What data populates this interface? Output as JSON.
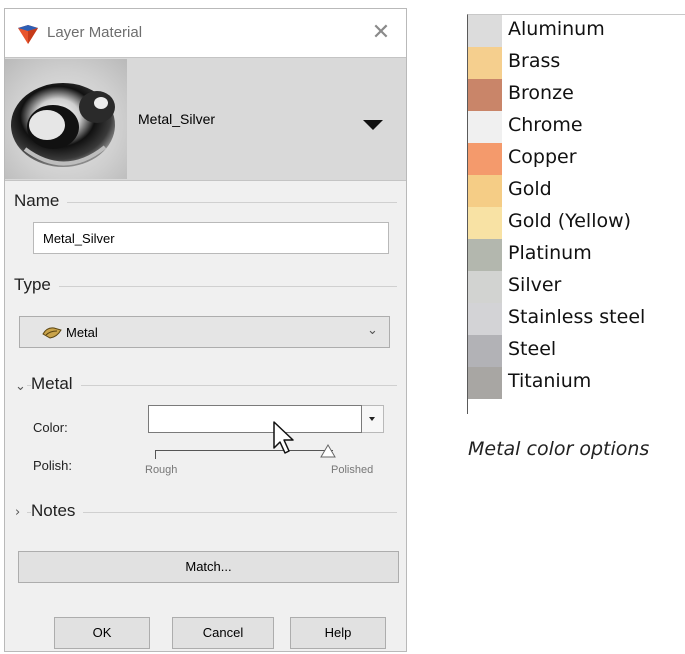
{
  "dialog": {
    "title": "Layer Material",
    "close_glyph": "✕",
    "preview": {
      "material_name": "Metal_Silver"
    },
    "name_section": {
      "label": "Name",
      "value": "Metal_Silver"
    },
    "type_section": {
      "label": "Type",
      "value": "Metal",
      "icon": "metal-icon"
    },
    "metal_section": {
      "label": "Metal",
      "color_label": "Color:",
      "polish_label": "Polish:",
      "polish_min": "Rough",
      "polish_max": "Polished",
      "polish_level": 0.97
    },
    "notes_section": {
      "label": "Notes"
    },
    "match_button": "Match...",
    "ok_button": "OK",
    "cancel_button": "Cancel",
    "help_button": "Help"
  },
  "legend": {
    "items": [
      {
        "label": "Aluminum",
        "color": "#dcdcdc"
      },
      {
        "label": "Brass",
        "color": "#f5cf8e"
      },
      {
        "label": "Bronze",
        "color": "#c98569"
      },
      {
        "label": "Chrome",
        "color": "#f0f0f0"
      },
      {
        "label": "Copper",
        "color": "#f49a6c"
      },
      {
        "label": "Gold",
        "color": "#f5cd86"
      },
      {
        "label": "Gold (Yellow)",
        "color": "#f8e2a4"
      },
      {
        "label": "Platinum",
        "color": "#b3b7ae"
      },
      {
        "label": "Silver",
        "color": "#d2d3d1"
      },
      {
        "label": "Stainless steel",
        "color": "#d3d3d6"
      },
      {
        "label": "Steel",
        "color": "#b2b2b6"
      },
      {
        "label": "Titanium",
        "color": "#a8a6a3"
      }
    ],
    "caption": "Metal color options"
  }
}
